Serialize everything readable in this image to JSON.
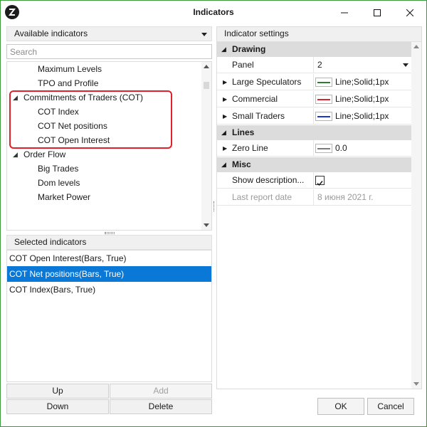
{
  "window": {
    "title": "Indicators"
  },
  "colors": {
    "accent": "#0a78d7",
    "window_border": "#3a9a3a",
    "highlight_box": "#e0202a",
    "category_bg": "#dcdcdc",
    "large_speculators_line": "#2e7d32",
    "commercial_line": "#e0202a",
    "small_traders_line": "#1a35d6",
    "zero_line": "#7a7a7a"
  },
  "icons": {
    "logo": "app-logo-icon",
    "minimize": "minimize-icon",
    "maximize": "maximize-icon",
    "close": "close-icon"
  },
  "available": {
    "header": "Available indicators",
    "search_placeholder": "Search",
    "tree": [
      {
        "label": "Maximum Levels",
        "level": 1
      },
      {
        "label": "TPO and Profile",
        "level": 1
      },
      {
        "label": "Commitments of Traders (COT)",
        "level": 0,
        "expanded": true
      },
      {
        "label": "COT Index",
        "level": 1
      },
      {
        "label": "COT Net positions",
        "level": 1
      },
      {
        "label": "COT Open Interest",
        "level": 1
      },
      {
        "label": "Order Flow",
        "level": 0,
        "expanded": true
      },
      {
        "label": "Big Trades",
        "level": 1
      },
      {
        "label": "Dom levels",
        "level": 1
      },
      {
        "label": "Market Power",
        "level": 1
      }
    ]
  },
  "selected": {
    "header": "Selected indicators",
    "items": [
      {
        "label": "COT Open Interest(Bars, True)",
        "selected": false
      },
      {
        "label": "COT Net positions(Bars, True)",
        "selected": true
      },
      {
        "label": "COT Index(Bars, True)",
        "selected": false
      }
    ]
  },
  "buttons": {
    "up": "Up",
    "add": "Add",
    "down": "Down",
    "delete": "Delete",
    "ok": "OK",
    "cancel": "Cancel"
  },
  "settings": {
    "header": "Indicator settings",
    "drawing": {
      "label": "Drawing",
      "panel_name": "Panel",
      "panel_value": "2",
      "large_speculators_name": "Large Speculators",
      "large_speculators_value": "Line;Solid;1px",
      "commercial_name": "Commercial",
      "commercial_value": "Line;Solid;1px",
      "small_traders_name": "Small Traders",
      "small_traders_value": "Line;Solid;1px"
    },
    "lines": {
      "label": "Lines",
      "zero_line_name": "Zero Line",
      "zero_line_value": "0.0"
    },
    "misc": {
      "label": "Misc",
      "show_description_name": "Show description...",
      "show_description_checked": true,
      "last_report_name": "Last report date",
      "last_report_value": "8 июня 2021 г."
    }
  }
}
